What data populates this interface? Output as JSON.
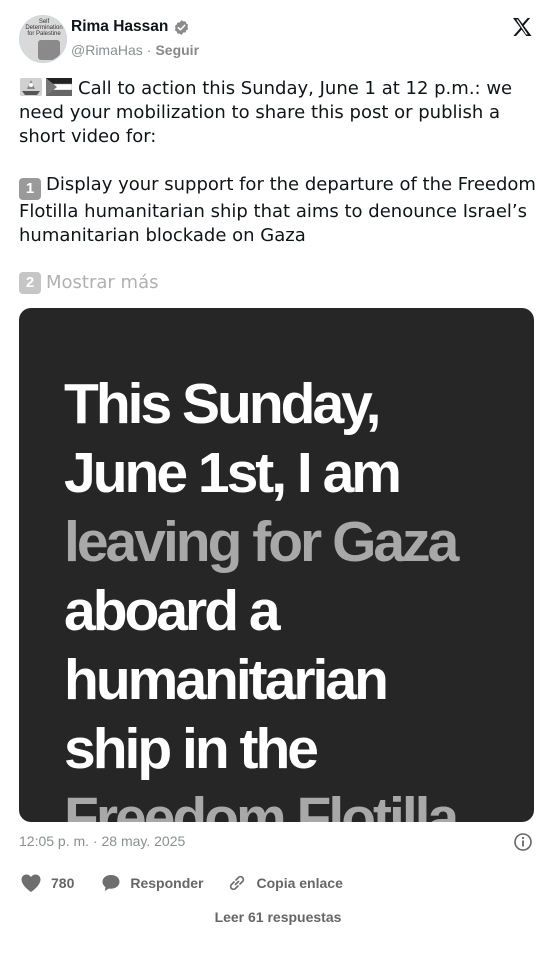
{
  "author": {
    "name": "Rima Hassan",
    "handle": "@RimaHas",
    "separator": "·",
    "follow_label": "Seguir",
    "avatar_text": "Self Determination for Palestine"
  },
  "icons": {
    "platform": "x-logo-icon",
    "verified": "verified-badge-icon",
    "info": "info-icon",
    "like": "heart-icon",
    "reply": "speech-bubble-icon",
    "copy_link": "link-icon"
  },
  "tweet": {
    "paragraph1": "Call to action this Sunday, June 1 at 12 p.m.: we need your mobilization to share this post or publish a short video for:",
    "paragraph1_emojis": [
      "ship-emoji",
      "palestine-flag-emoji"
    ],
    "point1_key": "1",
    "point1_text": "Display your support for the departure of the Freedom Flotilla humanitarian ship that aims to denounce Israel’s humanitarian blockade on Gaza",
    "point2_key": "2",
    "show_more_label": "Mostrar más"
  },
  "media": {
    "lines": [
      {
        "text": "This Sunday,",
        "tone": "white"
      },
      {
        "text": "June 1st, I am",
        "tone": "white"
      },
      {
        "text": "leaving for Gaza",
        "tone": "grey"
      },
      {
        "text": "aboard a",
        "tone": "white"
      },
      {
        "text": "humanitarian",
        "tone": "white"
      },
      {
        "text": "ship in the",
        "tone": "white"
      },
      {
        "text": "Freedom Flotilla",
        "tone": "grey"
      }
    ]
  },
  "timestamp": "12:05 p. m. · 28 may. 2025",
  "actions": {
    "likes_count": "780",
    "reply_label": "Responder",
    "copy_link_label": "Copia enlace"
  },
  "read_replies_label": "Leer 61 respuestas",
  "colors": {
    "text": "#0f1419",
    "secondary": "#8a8f94",
    "media_bg": "#262626",
    "media_highlight": "#a8a8a8"
  }
}
